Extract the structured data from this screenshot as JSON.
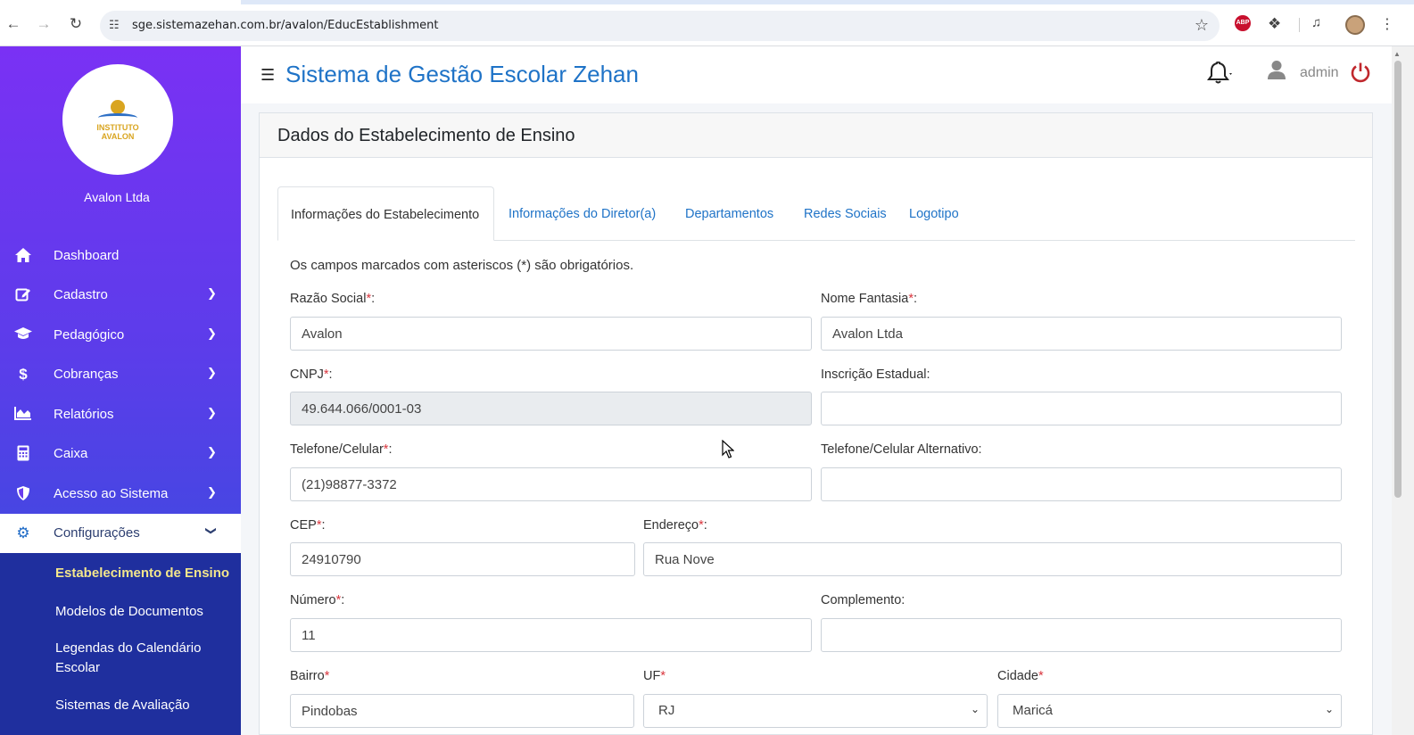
{
  "browser": {
    "url": "sge.sistemazehan.com.br/avalon/EducEstablishment",
    "abp_label": "ABP"
  },
  "sidebar": {
    "logo": {
      "line1": "INSTITUTO",
      "line2": "AVALON"
    },
    "org_name": "Avalon Ltda",
    "items": [
      {
        "label": "Dashboard",
        "icon": "home-icon",
        "has_chevron": false
      },
      {
        "label": "Cadastro",
        "icon": "edit-icon",
        "has_chevron": true
      },
      {
        "label": "Pedagógico",
        "icon": "graduation-cap-icon",
        "has_chevron": true
      },
      {
        "label": "Cobranças",
        "icon": "dollar-icon",
        "has_chevron": true
      },
      {
        "label": "Relatórios",
        "icon": "chart-area-icon",
        "has_chevron": true
      },
      {
        "label": "Caixa",
        "icon": "calculator-icon",
        "has_chevron": true
      },
      {
        "label": "Acesso ao Sistema",
        "icon": "shield-icon",
        "has_chevron": true
      },
      {
        "label": "Configurações",
        "icon": "gear-icon",
        "has_chevron": true,
        "expanded": true
      }
    ],
    "submenu": [
      {
        "label": "Estabelecimento de Ensino",
        "current": true
      },
      {
        "label": "Modelos de Documentos"
      },
      {
        "label": "Legendas do Calendário Escolar"
      },
      {
        "label": "Sistemas de Avaliação"
      }
    ]
  },
  "header": {
    "title": "Sistema de Gestão Escolar Zehan",
    "user": "admin"
  },
  "card": {
    "title": "Dados do Estabelecimento de Ensino",
    "tabs": [
      {
        "label": "Informações do Estabelecimento",
        "active": true
      },
      {
        "label": "Informações do Diretor(a)"
      },
      {
        "label": "Departamentos"
      },
      {
        "label": "Redes Sociais"
      },
      {
        "label": "Logotipo"
      }
    ],
    "note": "Os campos marcados com asteriscos (*) são obrigatórios."
  },
  "form": {
    "razao_social": {
      "label": "Razão Social",
      "required": true,
      "value": "Avalon"
    },
    "nome_fantasia": {
      "label": "Nome Fantasia",
      "required": true,
      "value": "Avalon Ltda"
    },
    "cnpj": {
      "label": "CNPJ",
      "required": true,
      "value": "49.644.066/0001-03"
    },
    "inscricao_estadual": {
      "label": "Inscrição Estadual:",
      "value": ""
    },
    "telefone": {
      "label": "Telefone/Celular",
      "required": true,
      "value": "(21)98877-3372"
    },
    "telefone_alt": {
      "label": "Telefone/Celular Alternativo:",
      "value": ""
    },
    "cep": {
      "label": "CEP",
      "required": true,
      "value": "24910790"
    },
    "endereco": {
      "label": "Endereço",
      "required": true,
      "value": "Rua Nove"
    },
    "numero": {
      "label": "Número",
      "required": true,
      "value": "11"
    },
    "complemento": {
      "label": "Complemento:",
      "value": ""
    },
    "bairro": {
      "label": "Bairro",
      "required": true,
      "value": "Pindobas"
    },
    "uf": {
      "label": "UF",
      "required": true,
      "value": "RJ"
    },
    "cidade": {
      "label": "Cidade",
      "required": true,
      "value": "Maricá"
    }
  },
  "symbols": {
    "asterisk": "*",
    "colon": ":"
  },
  "colors": {
    "sidebar_top": "#7a31f4",
    "sidebar_bottom": "#2c52d8",
    "submenu_bg": "#1f2f9e",
    "accent": "#1f73c7",
    "current_submenu": "#f3e68b",
    "required": "#d9363e",
    "power": "#c0282d"
  }
}
